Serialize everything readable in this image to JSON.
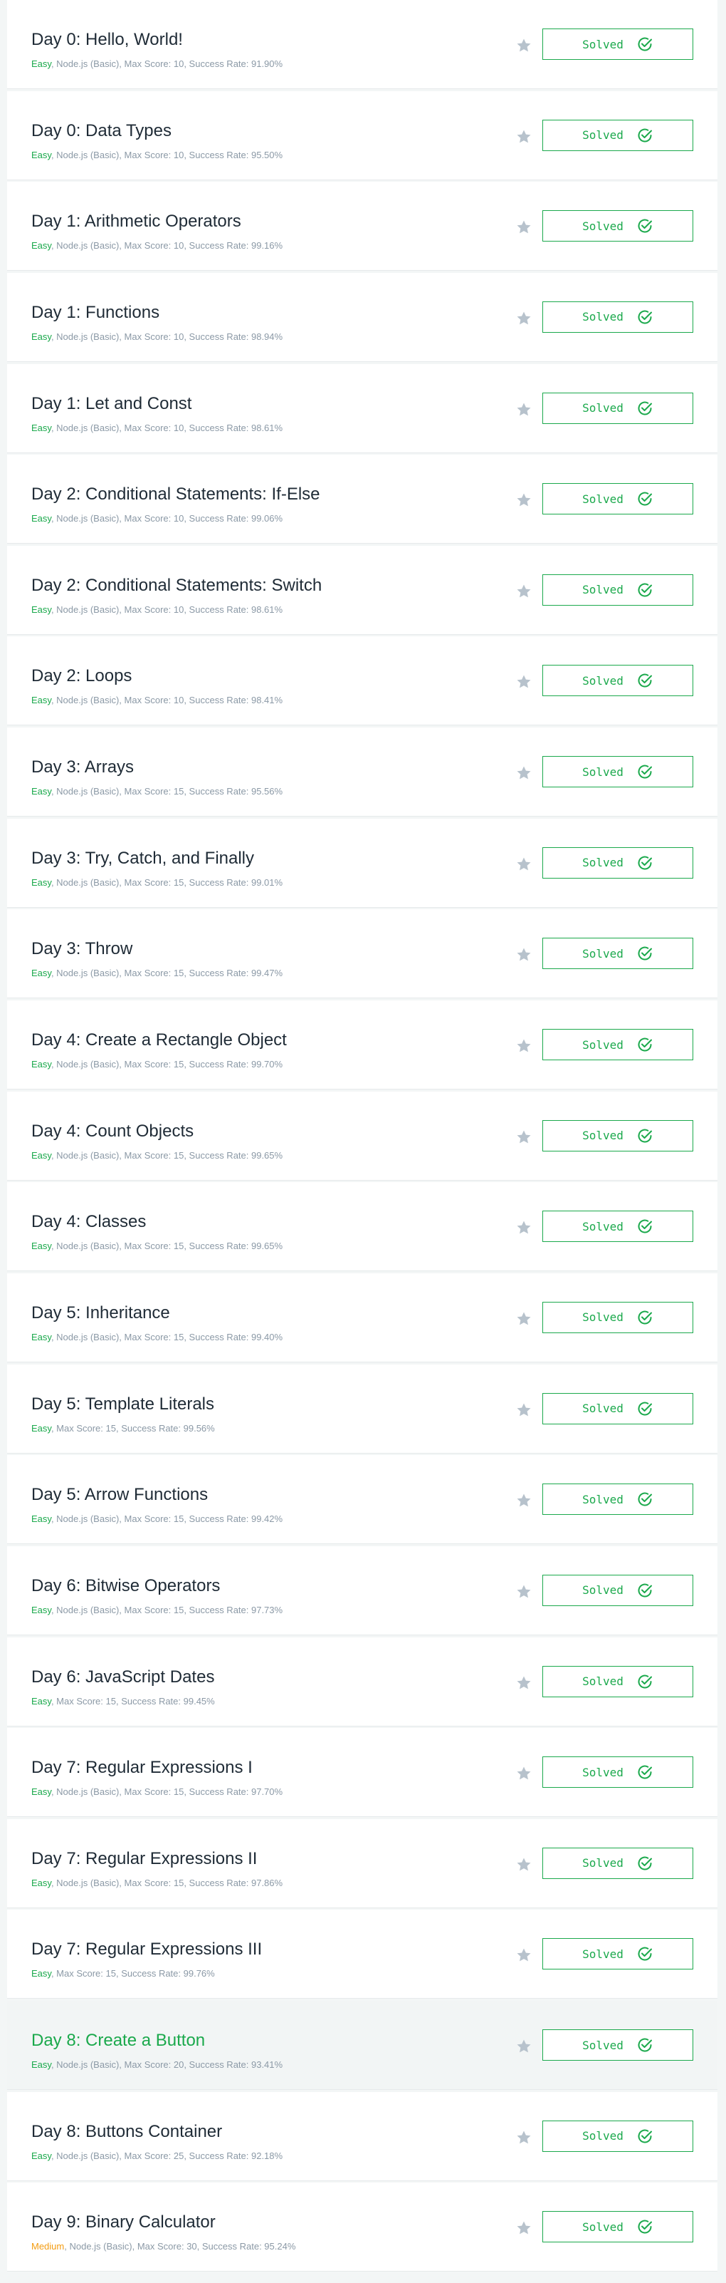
{
  "challenges": [
    {
      "title": "Day 0: Hello, World!",
      "difficulty": "Easy",
      "details": ", Node.js (Basic), Max Score: 10, Success Rate: 91.90%",
      "status": "Solved"
    },
    {
      "title": "Day 0: Data Types",
      "difficulty": "Easy",
      "details": ", Node.js (Basic), Max Score: 10, Success Rate: 95.50%",
      "status": "Solved"
    },
    {
      "title": "Day 1: Arithmetic Operators",
      "difficulty": "Easy",
      "details": ", Node.js (Basic), Max Score: 10, Success Rate: 99.16%",
      "status": "Solved"
    },
    {
      "title": "Day 1: Functions",
      "difficulty": "Easy",
      "details": ", Node.js (Basic), Max Score: 10, Success Rate: 98.94%",
      "status": "Solved"
    },
    {
      "title": "Day 1: Let and Const",
      "difficulty": "Easy",
      "details": ", Node.js (Basic), Max Score: 10, Success Rate: 98.61%",
      "status": "Solved"
    },
    {
      "title": "Day 2: Conditional Statements: If-Else",
      "difficulty": "Easy",
      "details": ", Node.js (Basic), Max Score: 10, Success Rate: 99.06%",
      "status": "Solved"
    },
    {
      "title": "Day 2: Conditional Statements: Switch",
      "difficulty": "Easy",
      "details": ", Node.js (Basic), Max Score: 10, Success Rate: 98.61%",
      "status": "Solved"
    },
    {
      "title": "Day 2: Loops",
      "difficulty": "Easy",
      "details": ", Node.js (Basic), Max Score: 10, Success Rate: 98.41%",
      "status": "Solved"
    },
    {
      "title": "Day 3: Arrays",
      "difficulty": "Easy",
      "details": ", Node.js (Basic), Max Score: 15, Success Rate: 95.56%",
      "status": "Solved"
    },
    {
      "title": "Day 3: Try, Catch, and Finally",
      "difficulty": "Easy",
      "details": ", Node.js (Basic), Max Score: 15, Success Rate: 99.01%",
      "status": "Solved"
    },
    {
      "title": "Day 3: Throw",
      "difficulty": "Easy",
      "details": ", Node.js (Basic), Max Score: 15, Success Rate: 99.47%",
      "status": "Solved"
    },
    {
      "title": "Day 4: Create a Rectangle Object",
      "difficulty": "Easy",
      "details": ", Node.js (Basic), Max Score: 15, Success Rate: 99.70%",
      "status": "Solved"
    },
    {
      "title": "Day 4: Count Objects",
      "difficulty": "Easy",
      "details": ", Node.js (Basic), Max Score: 15, Success Rate: 99.65%",
      "status": "Solved"
    },
    {
      "title": "Day 4: Classes",
      "difficulty": "Easy",
      "details": ", Node.js (Basic), Max Score: 15, Success Rate: 99.65%",
      "status": "Solved"
    },
    {
      "title": "Day 5: Inheritance",
      "difficulty": "Easy",
      "details": ", Node.js (Basic), Max Score: 15, Success Rate: 99.40%",
      "status": "Solved"
    },
    {
      "title": "Day 5: Template Literals",
      "difficulty": "Easy",
      "details": ", Max Score: 15, Success Rate: 99.56%",
      "status": "Solved"
    },
    {
      "title": "Day 5: Arrow Functions",
      "difficulty": "Easy",
      "details": ", Node.js (Basic), Max Score: 15, Success Rate: 99.42%",
      "status": "Solved"
    },
    {
      "title": "Day 6: Bitwise Operators",
      "difficulty": "Easy",
      "details": ", Node.js (Basic), Max Score: 15, Success Rate: 97.73%",
      "status": "Solved"
    },
    {
      "title": "Day 6: JavaScript Dates",
      "difficulty": "Easy",
      "details": ", Max Score: 15, Success Rate: 99.45%",
      "status": "Solved"
    },
    {
      "title": "Day 7: Regular Expressions I",
      "difficulty": "Easy",
      "details": ", Node.js (Basic), Max Score: 15, Success Rate: 97.70%",
      "status": "Solved"
    },
    {
      "title": "Day 7: Regular Expressions II",
      "difficulty": "Easy",
      "details": ", Node.js (Basic), Max Score: 15, Success Rate: 97.86%",
      "status": "Solved"
    },
    {
      "title": "Day 7: Regular Expressions III",
      "difficulty": "Easy",
      "details": ", Max Score: 15, Success Rate: 99.76%",
      "status": "Solved"
    },
    {
      "title": "Day 8: Create a Button",
      "difficulty": "Easy",
      "details": ", Node.js (Basic), Max Score: 20, Success Rate: 93.41%",
      "status": "Solved",
      "highlighted": true
    },
    {
      "title": "Day 8: Buttons Container",
      "difficulty": "Easy",
      "details": ", Node.js (Basic), Max Score: 25, Success Rate: 92.18%",
      "status": "Solved"
    },
    {
      "title": "Day 9: Binary Calculator",
      "difficulty": "Medium",
      "details": ", Node.js (Basic), Max Score: 30, Success Rate: 95.24%",
      "status": "Solved"
    }
  ],
  "colors": {
    "easy": "#1ba94c",
    "medium": "#f39c12",
    "solved": "#1ba94c",
    "star": "#b7c2cc"
  },
  "icons": {
    "bookmark": "star-icon",
    "solved": "check-circle-icon"
  }
}
